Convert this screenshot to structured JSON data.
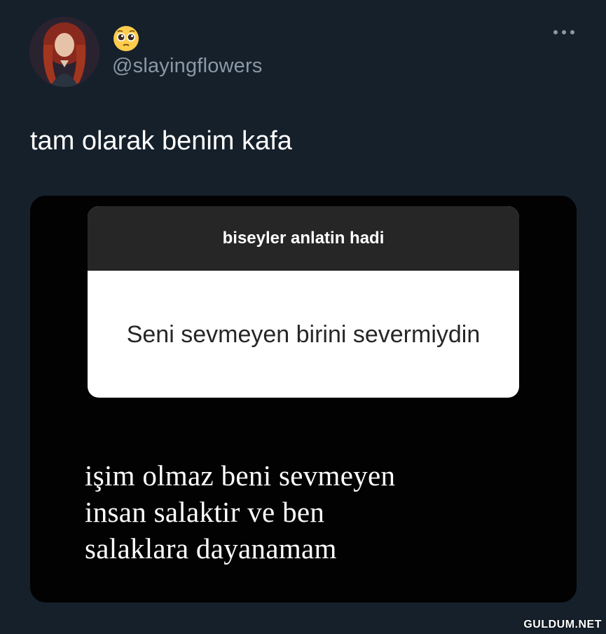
{
  "tweet": {
    "username": "@slayingflowers",
    "display_name_icon": "pleading-face-emoji",
    "text": "tam olarak benim kafa",
    "more_icon": "more-options-icon"
  },
  "media": {
    "question_header": "biseyler anlatin hadi",
    "question_text": "Seni sevmeyen birini severmiydin",
    "answer_lines": [
      "işim olmaz beni sevmeyen",
      "insan salaktir ve ben",
      "salaklara dayanamam"
    ]
  },
  "watermark": "GULDUM.NET",
  "colors": {
    "background": "#15202b",
    "secondary_text": "#8b98a5",
    "media_background": "#020202",
    "question_header_bg": "#262626"
  }
}
